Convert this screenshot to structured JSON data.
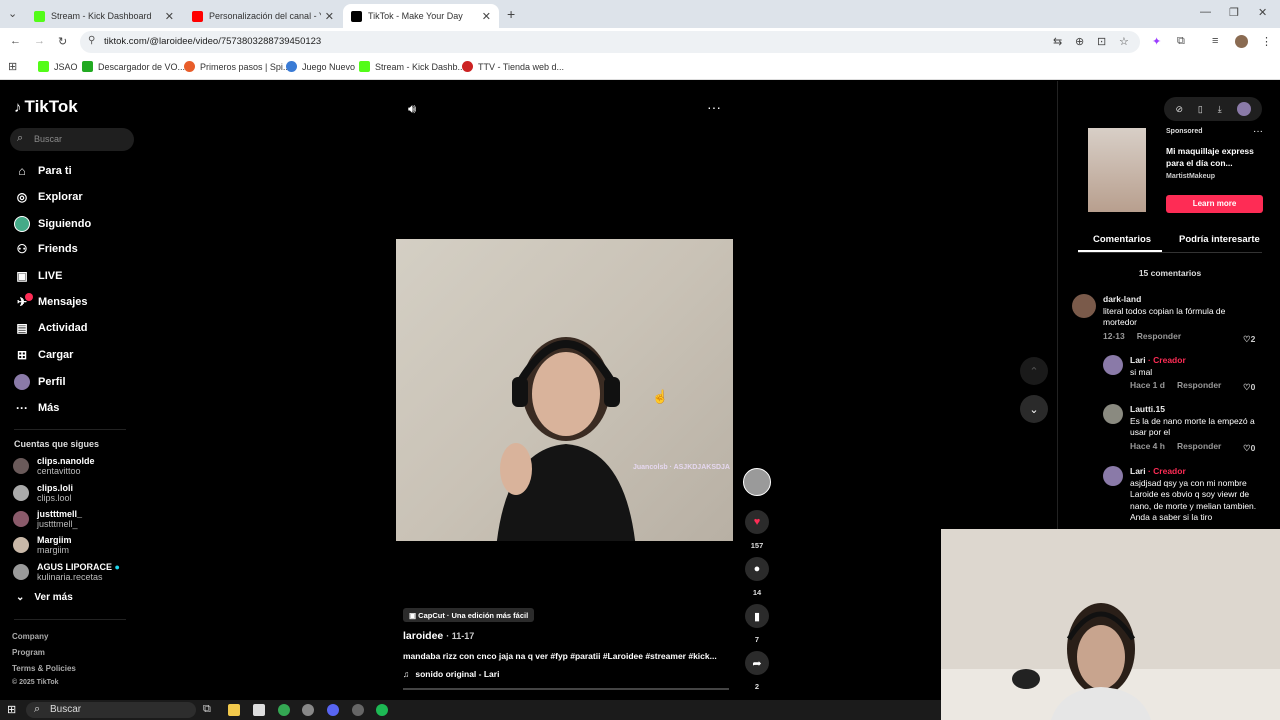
{
  "browser": {
    "tabs": [
      {
        "title": "Stream - Kick Dashboard",
        "active": false,
        "favicon_color": "#53fc18"
      },
      {
        "title": "Personalización del canal - You",
        "active": false,
        "favicon_color": "#ff0000"
      },
      {
        "title": "TikTok - Make Your Day",
        "active": true,
        "favicon_color": "#000000"
      }
    ],
    "url": "tiktok.com/@laroidee/video/7573803288739450123",
    "bookmarks": [
      {
        "label": "JSAO",
        "color": "#53fc18"
      },
      {
        "label": "Descargador de VO...",
        "color": "#22aa22"
      },
      {
        "label": "Primeros pasos | Spi...",
        "color": "#e85d2a"
      },
      {
        "label": "Juego Nuevo",
        "color": "#3a7bd5"
      },
      {
        "label": "Stream - Kick Dashb...",
        "color": "#53fc18"
      },
      {
        "label": "TTV - Tienda web d...",
        "color": "#cc2222"
      }
    ]
  },
  "tiktok": {
    "logo": "TikTok",
    "search_placeholder": "Buscar",
    "nav": [
      {
        "label": "Para ti",
        "icon": "home-icon"
      },
      {
        "label": "Explorar",
        "icon": "compass-icon"
      },
      {
        "label": "Siguiendo",
        "icon": "following-icon"
      },
      {
        "label": "Friends",
        "icon": "friends-icon"
      },
      {
        "label": "LIVE",
        "icon": "live-icon"
      },
      {
        "label": "Mensajes",
        "icon": "messages-icon",
        "badge": "1"
      },
      {
        "label": "Actividad",
        "icon": "activity-icon"
      },
      {
        "label": "Cargar",
        "icon": "upload-icon"
      },
      {
        "label": "Perfil",
        "icon": "profile-avatar"
      },
      {
        "label": "Más",
        "icon": "more-icon"
      }
    ],
    "following_title": "Cuentas que sigues",
    "following": [
      {
        "name": "clips.nanolde",
        "handle": "centavittoo"
      },
      {
        "name": "clips.loli",
        "handle": "clips.lool"
      },
      {
        "name": "justttmell_",
        "handle": "justttmell_"
      },
      {
        "name": "Margiim",
        "handle": "margiim"
      },
      {
        "name": "AGUS LIPORACE",
        "handle": "kulinaria.recetas",
        "verified": true
      }
    ],
    "see_more": "Ver más",
    "footer": [
      "Company",
      "Program",
      "Terms & Policies",
      "© 2025 TikTok"
    ],
    "video": {
      "watermark": "Juancolsb · ASJKDJAKSDJA",
      "capcut_label": "CapCut · Una edición más fácil",
      "author": "laroidee",
      "date": "· 11-17",
      "caption": "mandaba rizz con cnco jaja na q ver #fyp #paratii #Laroidee #streamer #kick...",
      "sound": "sonido original - Lari",
      "likes": "157",
      "comments": "14",
      "saves": "7",
      "shares": "2"
    },
    "ad": {
      "sponsored": "Sponsored",
      "title": "Mi maquillaje express para el día con...",
      "brand": "MartistMakeup",
      "cta": "Learn more"
    },
    "tabs": [
      "Comentarios",
      "Podría interesarte"
    ],
    "comment_count": "15 comentarios",
    "comments": [
      {
        "name": "dark-land",
        "creator": "",
        "text": "literal todos copian la fórmula de mortedor",
        "time": "12-13",
        "reply": "Responder",
        "likes": "2"
      },
      {
        "name": "Lari",
        "creator": "· Creador",
        "text": "si mal",
        "time": "Hace 1 d",
        "reply": "Responder",
        "likes": "0"
      },
      {
        "name": "Lautti.15",
        "creator": "",
        "text": "Es la de nano morte la empezó a usar por el",
        "time": "Hace 4 h",
        "reply": "Responder",
        "likes": "0"
      },
      {
        "name": "Lari",
        "creator": "· Creador",
        "text": "asjdjsad qsy ya con mi nombre Laroide es obvio q soy viewr de nano, de morte y melian tambien. Anda a saber si la tiro",
        "time": "",
        "reply": "",
        "likes": ""
      }
    ]
  },
  "taskbar": {
    "search": "Buscar"
  }
}
